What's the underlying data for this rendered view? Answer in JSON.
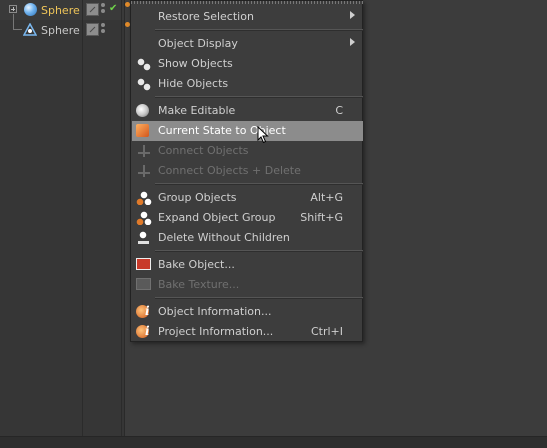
{
  "object_manager": {
    "objects": [
      {
        "name": "Sphere",
        "selected": true,
        "icon": "sphere-icon",
        "enabled": true
      },
      {
        "name": "Sphere",
        "selected": false,
        "icon": "instance-icon"
      }
    ]
  },
  "context_menu": {
    "items": [
      {
        "label": "Restore Selection",
        "shortcut": "",
        "submenu": true,
        "icon": "",
        "state": "normal"
      },
      {
        "label": "Object Display",
        "shortcut": "",
        "submenu": true,
        "icon": "",
        "state": "normal"
      },
      {
        "label": "Show Objects",
        "shortcut": "",
        "icon": "show-objects-icon",
        "state": "normal"
      },
      {
        "label": "Hide Objects",
        "shortcut": "",
        "icon": "hide-objects-icon",
        "state": "normal"
      },
      {
        "label": "Make Editable",
        "shortcut": "C",
        "icon": "make-editable-icon",
        "state": "normal"
      },
      {
        "label": "Current State to Object",
        "shortcut": "",
        "icon": "current-state-icon",
        "state": "highlighted"
      },
      {
        "label": "Connect Objects",
        "shortcut": "",
        "icon": "connect-objects-icon",
        "state": "disabled"
      },
      {
        "label": "Connect Objects + Delete",
        "shortcut": "",
        "icon": "connect-delete-icon",
        "state": "disabled"
      },
      {
        "label": "Group Objects",
        "shortcut": "Alt+G",
        "icon": "group-objects-icon",
        "state": "normal"
      },
      {
        "label": "Expand Object Group",
        "shortcut": "Shift+G",
        "icon": "expand-group-icon",
        "state": "normal"
      },
      {
        "label": "Delete Without Children",
        "shortcut": "",
        "icon": "delete-without-children-icon",
        "state": "normal"
      },
      {
        "label": "Bake Object...",
        "shortcut": "",
        "icon": "bake-object-icon",
        "state": "normal"
      },
      {
        "label": "Bake Texture...",
        "shortcut": "",
        "icon": "bake-texture-icon",
        "state": "disabled"
      },
      {
        "label": "Object Information...",
        "shortcut": "",
        "icon": "object-info-icon",
        "state": "normal"
      },
      {
        "label": "Project Information...",
        "shortcut": "Ctrl+I",
        "icon": "project-info-icon",
        "state": "normal"
      }
    ]
  },
  "colors": {
    "selected_object": "#f0c65a",
    "highlight": "#8c8c8c",
    "enabled_check": "#6fd34a"
  }
}
